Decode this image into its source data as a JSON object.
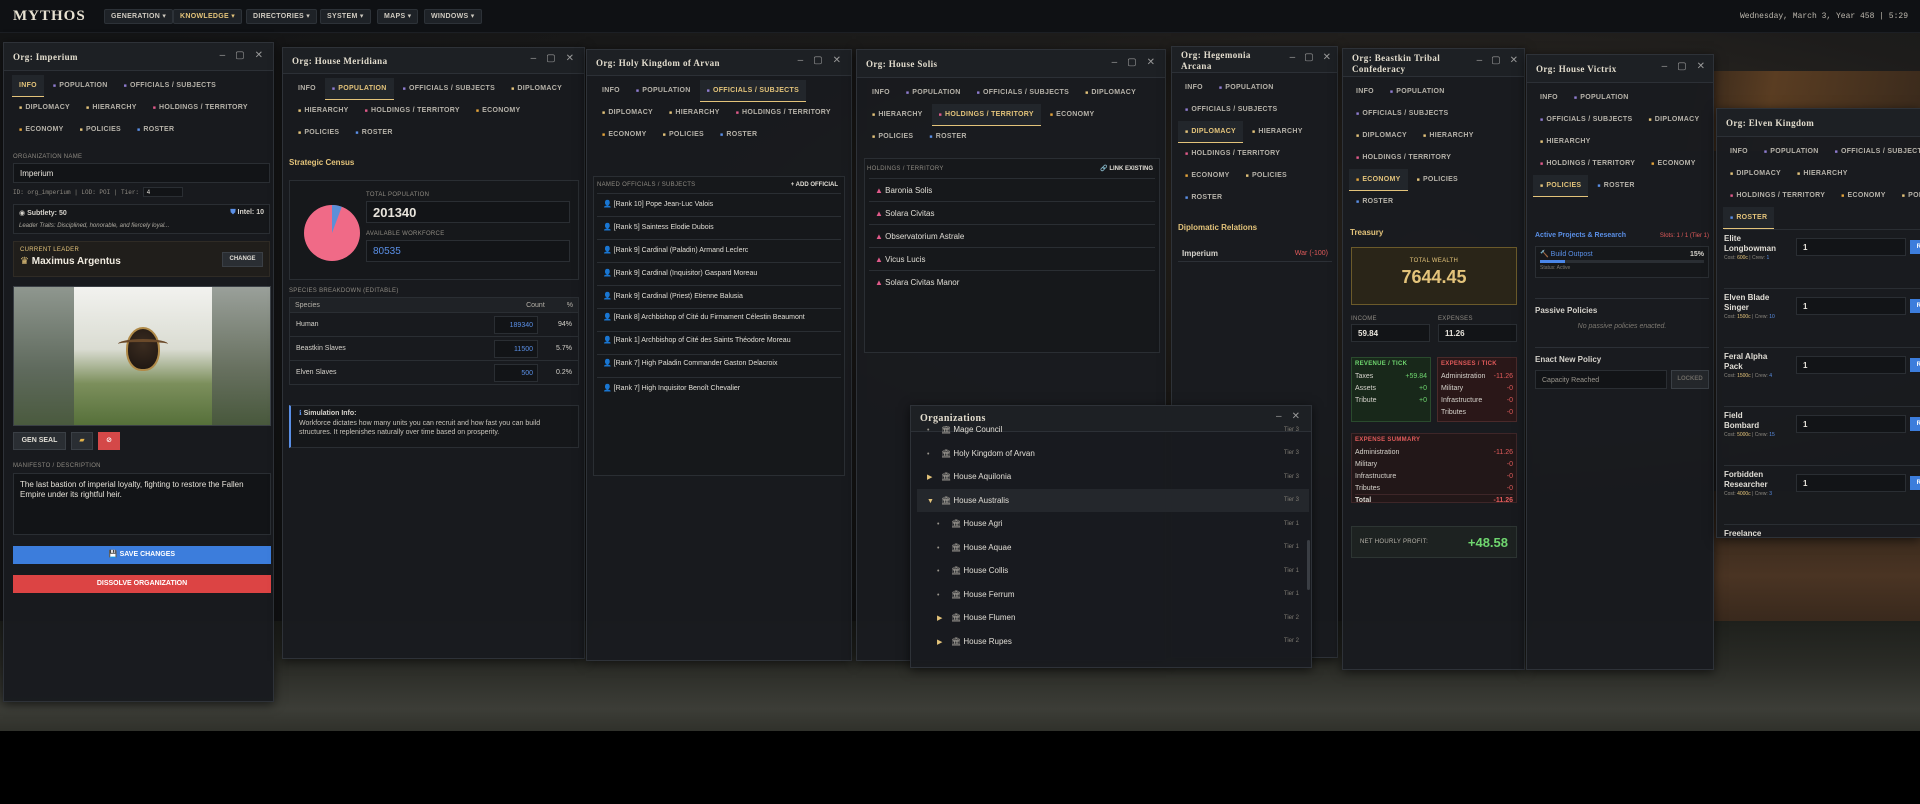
{
  "app": {
    "logo": "MYTHOS",
    "menus": [
      "GENERATION ▾",
      "KNOWLEDGE ▾",
      "DIRECTORIES ▾",
      "SYSTEM ▾",
      "MAPS ▾",
      "WINDOWS ▾"
    ],
    "clock": "Wednesday, March 3, Year 458 | 5:29"
  },
  "imperium": {
    "title": "Org: Imperium",
    "tabs": [
      "INFO",
      "POPULATION",
      "OFFICIALS / SUBJECTS",
      "DIPLOMACY",
      "HIERARCHY",
      "HOLDINGS / TERRITORY",
      "ECONOMY",
      "POLICIES",
      "ROSTER"
    ],
    "org_name_label": "ORGANIZATION NAME",
    "org_name": "Imperium",
    "id_line": "ID: org_imperium | LOD: POI | Tier:",
    "tier": "4",
    "subtlety": "Subtlety: 50",
    "intel": "Intel: 10",
    "traits": "Leader Traits: Disciplined, honorable, and fiercely loyal...",
    "leader_label": "CURRENT LEADER",
    "leader": "Maximus Argentus",
    "change": "CHANGE",
    "gen_seal": "GEN SEAL",
    "manifesto_label": "MANIFESTO / DESCRIPTION",
    "manifesto": "The last bastion of imperial loyalty, fighting to restore the Fallen Empire under its rightful heir.",
    "save": "💾 SAVE CHANGES",
    "dissolve": "DISSOLVE ORGANIZATION"
  },
  "meridiana": {
    "title": "Org: House Meridiana",
    "tabs": [
      "INFO",
      "POPULATION",
      "OFFICIALS / SUBJECTS",
      "DIPLOMACY",
      "HIERARCHY",
      "HOLDINGS / TERRITORY",
      "ECONOMY",
      "POLICIES",
      "ROSTER"
    ],
    "census": "Strategic Census",
    "total_label": "TOTAL POPULATION",
    "total": "201340",
    "workforce_label": "AVAILABLE WORKFORCE",
    "workforce": "80535",
    "breakdown": "SPECIES BREAKDOWN (EDITABLE)",
    "cols": [
      "Species",
      "Count",
      "%"
    ],
    "species": [
      {
        "name": "Human",
        "count": "189340",
        "pct": "94%"
      },
      {
        "name": "Beastkin Slaves",
        "count": "11500",
        "pct": "5.7%"
      },
      {
        "name": "Elven Slaves",
        "count": "500",
        "pct": "0.2%"
      }
    ],
    "sim_title": "Simulation Info:",
    "sim_text": "Workforce dictates how many units you can recruit and how fast you can build structures. It replenishes naturally over time based on prosperity."
  },
  "arvan": {
    "title": "Org: Holy Kingdom of Arvan",
    "tabs": [
      "INFO",
      "POPULATION",
      "OFFICIALS / SUBJECTS",
      "DIPLOMACY",
      "HIERARCHY",
      "HOLDINGS / TERRITORY",
      "ECONOMY",
      "POLICIES",
      "ROSTER"
    ],
    "section": "NAMED OFFICIALS / SUBJECTS",
    "add": "+ ADD OFFICIAL",
    "officials": [
      "[Rank 10] Pope Jean-Luc Valois",
      "[Rank 5] Saintess Elodie Dubois",
      "[Rank 9] Cardinal (Paladin) Armand Leclerc",
      "[Rank 9] Cardinal (Inquisitor) Gaspard Moreau",
      "[Rank 9] Cardinal (Priest) Etienne Balusia",
      "[Rank 8] Archbishop of Cité du Firmament Célestin Beaumont",
      "[Rank 1] Archbishop of Cité des Saints Théodore Moreau",
      "[Rank 7] High Paladin Commander Gaston Delacroix",
      "[Rank 7] High Inquisitor Benoît Chevalier"
    ]
  },
  "solis": {
    "title": "Org: House Solis",
    "tabs": [
      "INFO",
      "POPULATION",
      "OFFICIALS / SUBJECTS",
      "DIPLOMACY",
      "HIERARCHY",
      "HOLDINGS / TERRITORY",
      "ECONOMY",
      "POLICIES",
      "ROSTER"
    ],
    "section": "HOLDINGS / TERRITORY",
    "link": "🔗 LINK EXISTING",
    "holdings": [
      "Baronia Solis",
      "Solara Civitas",
      "Observatorium Astrale",
      "Vicus Lucis",
      "Solara Civitas Manor"
    ]
  },
  "hegemonia": {
    "title": "Org: Hegemonia Arcana",
    "tabs": [
      "INFO",
      "POPULATION",
      "OFFICIALS / SUBJECTS",
      "DIPLOMACY",
      "HIERARCHY",
      "HOLDINGS / TERRITORY",
      "ECONOMY",
      "POLICIES",
      "ROSTER"
    ],
    "relations": "Diplomatic Relations",
    "rel_name": "Imperium",
    "rel_status": "War (-100)"
  },
  "beastkin": {
    "title": "Org: Beastkin Tribal Confederacy",
    "tabs": [
      "INFO",
      "POPULATION",
      "OFFICIALS / SUBJECTS",
      "DIPLOMACY",
      "HIERARCHY",
      "HOLDINGS / TERRITORY",
      "ECONOMY",
      "POLICIES",
      "ROSTER"
    ],
    "treasury": "Treasury",
    "wealth_label": "TOTAL WEALTH",
    "wealth": "7644.45",
    "income_label": "INCOME",
    "income": "59.84",
    "expenses_label": "EXPENSES",
    "expenses": "11.26",
    "rev_title": "REVENUE / TICK",
    "revenue": [
      {
        "k": "Taxes",
        "v": "+59.84"
      },
      {
        "k": "Assets",
        "v": "+0"
      },
      {
        "k": "Tribute",
        "v": "+0"
      }
    ],
    "exp_title": "EXPENSES / TICK",
    "exp": [
      {
        "k": "Administration",
        "v": "-11.26"
      },
      {
        "k": "Military",
        "v": "-0"
      },
      {
        "k": "Infrastructure",
        "v": "-0"
      },
      {
        "k": "Tributes",
        "v": "-0"
      }
    ],
    "summary_title": "EXPENSE SUMMARY",
    "summary": [
      {
        "k": "Administration",
        "v": "-11.26"
      },
      {
        "k": "Military",
        "v": "-0"
      },
      {
        "k": "Infrastructure",
        "v": "-0"
      },
      {
        "k": "Tributes",
        "v": "-0"
      },
      {
        "k": "Total",
        "v": "-11.26"
      }
    ],
    "profit_label": "NET HOURLY PROFIT:",
    "profit": "+48.58"
  },
  "victrix": {
    "title": "Org: House Victrix",
    "tabs": [
      "INFO",
      "POPULATION",
      "OFFICIALS / SUBJECTS",
      "DIPLOMACY",
      "HIERARCHY",
      "HOLDINGS / TERRITORY",
      "ECONOMY",
      "POLICIES",
      "ROSTER"
    ],
    "projects": "Active Projects & Research",
    "slots": "Slots: 1 / 1 (Tier 1)",
    "project": "🔨 Build Outpost",
    "project_pct": "15%",
    "project_status": "Status: Active",
    "project_progress": 0.15,
    "passive": "Passive Policies",
    "no_passive": "No passive policies enacted.",
    "enact": "Enact New Policy",
    "capacity": "Capacity Reached",
    "locked": "LOCKED"
  },
  "elven": {
    "title": "Org: Elven Kingdom",
    "tabs": [
      "INFO",
      "POPULATION",
      "OFFICIALS / SUBJECTS",
      "DIPLOMACY",
      "HIERARCHY",
      "HOLDINGS / TERRITORY",
      "ECONOMY",
      "POLICIES",
      "ROSTER"
    ],
    "recruit": "RECRUIT",
    "units": [
      {
        "name": "Elite Longbowman",
        "cost": "600c",
        "crew": "1",
        "qty": "1"
      },
      {
        "name": "Elven Blade Singer",
        "cost": "1500c",
        "crew": "10",
        "qty": "1"
      },
      {
        "name": "Feral Alpha Pack",
        "cost": "1500c",
        "crew": "4",
        "qty": "1"
      },
      {
        "name": "Field Bombard",
        "cost": "5000c",
        "crew": "15",
        "qty": "1"
      },
      {
        "name": "Forbidden Researcher",
        "cost": "4000c",
        "crew": "3",
        "qty": "1"
      },
      {
        "name": "Freelance",
        "cost": "",
        "crew": "",
        "qty": ""
      }
    ],
    "cost_prefix": "Cost:",
    "crew_prefix": "Crew:"
  },
  "orgs": {
    "title": "Organizations",
    "items": [
      {
        "name": "Mage Council",
        "tier": "Tier 3",
        "indent": 0,
        "exp": "•"
      },
      {
        "name": "Holy Kingdom of Arvan",
        "tier": "Tier 3",
        "indent": 0,
        "exp": "•"
      },
      {
        "name": "House Aquilonia",
        "tier": "Tier 3",
        "indent": 0,
        "exp": "▶"
      },
      {
        "name": "House Australis",
        "tier": "Tier 3",
        "indent": 0,
        "exp": "▼"
      },
      {
        "name": "House Agri",
        "tier": "Tier 1",
        "indent": 1,
        "exp": "•"
      },
      {
        "name": "House Aquae",
        "tier": "Tier 1",
        "indent": 1,
        "exp": "•"
      },
      {
        "name": "House Collis",
        "tier": "Tier 1",
        "indent": 1,
        "exp": "•"
      },
      {
        "name": "House Ferrum",
        "tier": "Tier 1",
        "indent": 1,
        "exp": "•"
      },
      {
        "name": "House Flumen",
        "tier": "Tier 2",
        "indent": 1,
        "exp": "▶"
      },
      {
        "name": "House Rupes",
        "tier": "Tier 2",
        "indent": 1,
        "exp": "▶"
      }
    ]
  },
  "colors": {
    "accent": "#e3c37a",
    "danger": "#e05a5a",
    "primary": "#4a86e8",
    "positive": "#6fd66f",
    "pie_main": "#f06a87",
    "pie_minor": "#5b8fd8"
  }
}
